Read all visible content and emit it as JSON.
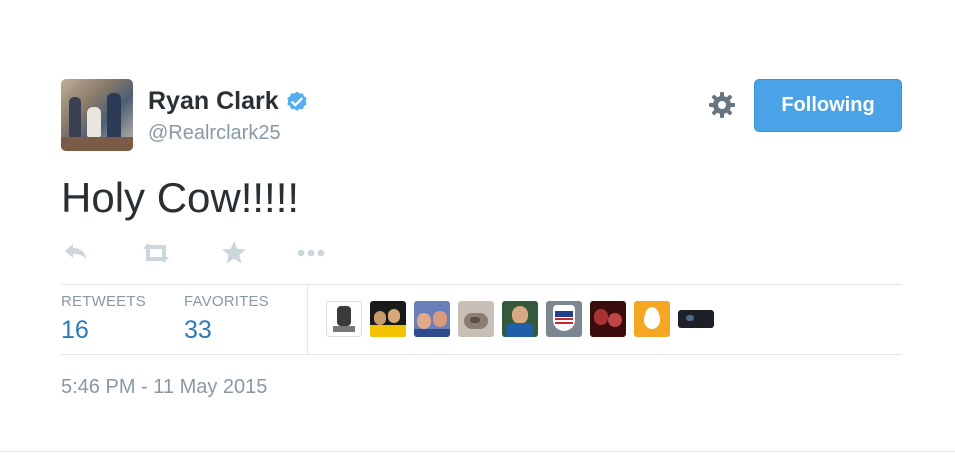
{
  "user": {
    "name": "Ryan Clark",
    "handle": "@Realrclark25",
    "verified": true
  },
  "follow_button": {
    "label": "Following",
    "color": "#4aa3e6"
  },
  "tweet": {
    "text": "Holy Cow!!!!!"
  },
  "actions": [
    "reply-icon",
    "retweet-icon",
    "favorite-icon",
    "more-icon"
  ],
  "stats": {
    "retweets": {
      "label": "RETWEETS",
      "value": "16"
    },
    "favorites": {
      "label": "FAVORITES",
      "value": "33"
    }
  },
  "avatars": [
    {
      "color": "#ffffff"
    },
    {
      "color": "#1a1a1a"
    },
    {
      "color": "#6a7fb8"
    },
    {
      "color": "#9c8f86"
    },
    {
      "color": "#345a3b"
    },
    {
      "color": "#7c8792"
    },
    {
      "color": "#6a1d1d"
    },
    {
      "color": "#f5a623"
    },
    {
      "color": "#1d2028"
    }
  ],
  "timestamp": "5:46 PM - 11 May 2015",
  "colors": {
    "link": "#2b7bb9",
    "muted": "#8899a6",
    "text": "#292f33"
  }
}
